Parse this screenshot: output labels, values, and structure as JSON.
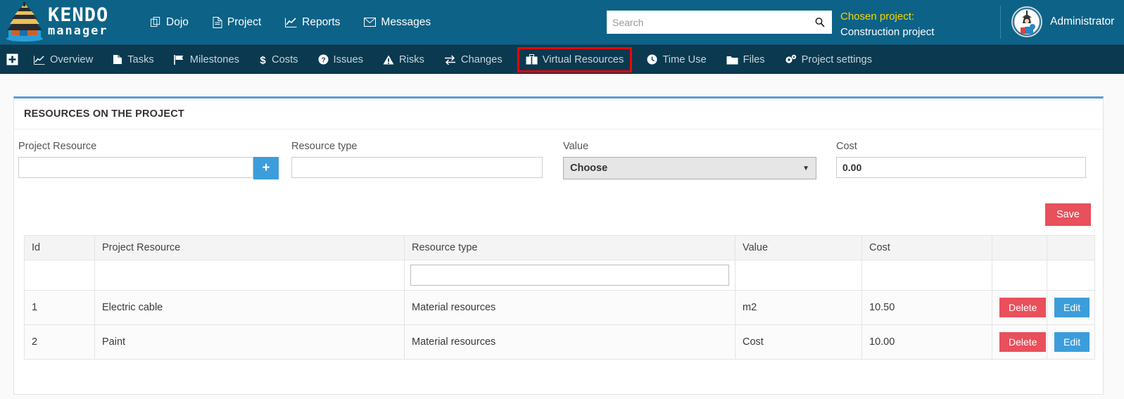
{
  "header": {
    "logo": {
      "line1": "KENDO",
      "line2": "manager",
      "icon": "pagoda-logo-icon"
    },
    "nav": [
      {
        "label": "Dojo",
        "icon": "copy-icon"
      },
      {
        "label": "Project",
        "icon": "file-icon"
      },
      {
        "label": "Reports",
        "icon": "chart-line-icon"
      },
      {
        "label": "Messages",
        "icon": "envelope-icon"
      }
    ],
    "search": {
      "value": "",
      "placeholder": "Search",
      "icon": "search-icon"
    },
    "chosen_project": {
      "label": "Chosen project:",
      "value": "Construction project"
    },
    "user": {
      "name": "Administrator",
      "avatar": "samurai-avatar-icon"
    }
  },
  "subnav": {
    "plus_icon": "plus-square-icon",
    "items": [
      {
        "label": "Overview",
        "icon": "chart-line-icon",
        "highlighted": false
      },
      {
        "label": "Tasks",
        "icon": "file-copy-icon",
        "highlighted": false
      },
      {
        "label": "Milestones",
        "icon": "flag-icon",
        "highlighted": false
      },
      {
        "label": "Costs",
        "icon": "dollar-icon",
        "highlighted": false
      },
      {
        "label": "Issues",
        "icon": "question-circle-icon",
        "highlighted": false
      },
      {
        "label": "Risks",
        "icon": "warning-triangle-icon",
        "highlighted": false
      },
      {
        "label": "Changes",
        "icon": "exchange-icon",
        "highlighted": false
      },
      {
        "label": "Virtual Resources",
        "icon": "briefcase-icon",
        "highlighted": true
      },
      {
        "label": "Time Use",
        "icon": "clock-icon",
        "highlighted": false
      },
      {
        "label": "Files",
        "icon": "folder-icon",
        "highlighted": false
      },
      {
        "label": "Project settings",
        "icon": "gears-icon",
        "highlighted": false
      }
    ],
    "highlight_color": "#ff0000"
  },
  "panel": {
    "title": "RESOURCES ON THE PROJECT",
    "form": {
      "project_resource": {
        "label": "Project Resource",
        "value": "",
        "placeholder": "",
        "add_label": "+"
      },
      "resource_type": {
        "label": "Resource type",
        "value": "",
        "placeholder": ""
      },
      "value": {
        "label": "Value",
        "selected": "Choose",
        "caret": "▼"
      },
      "cost": {
        "label": "Cost",
        "value": "0.00"
      }
    },
    "save_label": "Save"
  },
  "table": {
    "columns": [
      "Id",
      "Project Resource",
      "Resource type",
      "Value",
      "Cost",
      "",
      ""
    ],
    "filter_row": {
      "resource_type_filter": "",
      "placeholder": ""
    },
    "rows": [
      {
        "id": "1",
        "project_resource": "Electric cable",
        "resource_type": "Material resources",
        "value": "m2",
        "cost": "10.50",
        "delete_label": "Delete",
        "edit_label": "Edit"
      },
      {
        "id": "2",
        "project_resource": "Paint",
        "resource_type": "Material resources",
        "value": "Cost",
        "cost": "10.00",
        "delete_label": "Delete",
        "edit_label": "Edit"
      }
    ]
  },
  "colors": {
    "header_blue": "#0d6287",
    "subnav_navy": "#0a3950",
    "accent_blue": "#3c9ddb",
    "panel_top_border": "#5b9bd5",
    "danger_red": "#e8505b",
    "chosen_label_yellow": "#f3d900",
    "highlight_red": "#ff0000"
  }
}
